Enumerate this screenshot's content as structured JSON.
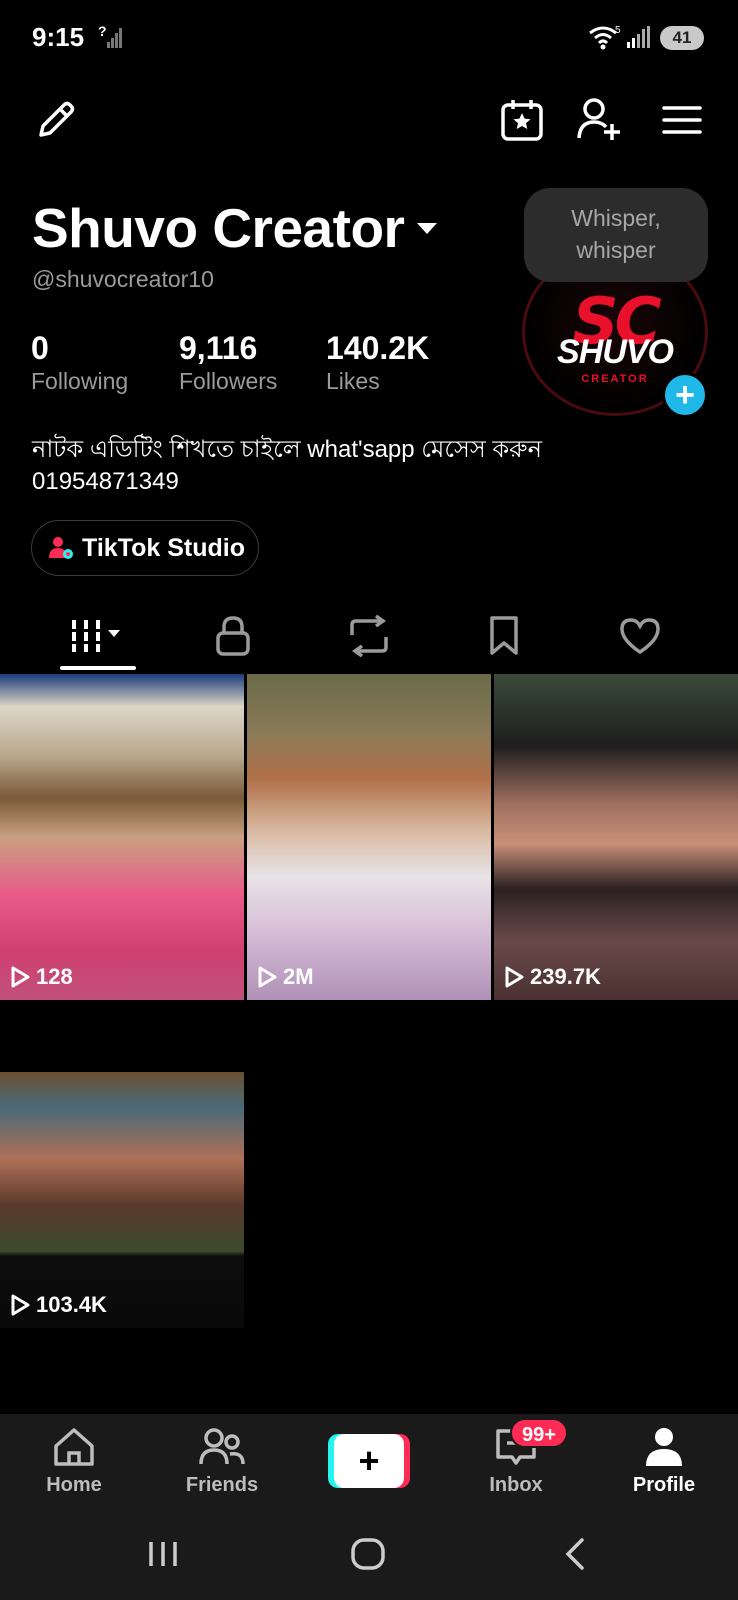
{
  "status_bar": {
    "time": "9:15",
    "sim_label": "?",
    "wifi_label": "5",
    "battery": "41"
  },
  "top_actions": {
    "icons": [
      "edit-icon",
      "calendar-star-icon",
      "add-friend-icon",
      "menu-icon"
    ]
  },
  "profile": {
    "display_name": "Shuvo Creator",
    "handle": "@shuvocreator10",
    "stats": [
      {
        "value": "0",
        "label": "Following"
      },
      {
        "value": "9,116",
        "label": "Followers"
      },
      {
        "value": "140.2K",
        "label": "Likes"
      }
    ],
    "bio_line_1": "নাটক এডিটিং শিখতে চাইলে  what'sapp মেসেস করুন",
    "bio_line_2": "01954871349",
    "studio_button": "TikTok Studio",
    "tooltip": {
      "line1": "Whisper,",
      "line2": "whisper"
    },
    "avatar_logo": {
      "mark": "SC",
      "name": "SHUVO",
      "sub": "CREATOR"
    }
  },
  "tabs": [
    {
      "name": "videos",
      "icon": "grid-icon",
      "active": true
    },
    {
      "name": "private",
      "icon": "lock-icon"
    },
    {
      "name": "reposts",
      "icon": "repost-icon"
    },
    {
      "name": "saved",
      "icon": "bookmark-icon"
    },
    {
      "name": "liked",
      "icon": "heart-icon"
    }
  ],
  "videos": [
    {
      "views": "128"
    },
    {
      "views": "2M"
    },
    {
      "views": "239.7K"
    },
    {
      "views": "103.4K"
    }
  ],
  "bottom_nav": {
    "items": [
      {
        "label": "Home",
        "icon": "home-icon"
      },
      {
        "label": "Friends",
        "icon": "friends-icon"
      },
      {
        "label": "Inbox",
        "icon": "inbox-icon"
      },
      {
        "label": "Profile",
        "icon": "profile-icon",
        "active": true
      }
    ],
    "create_label": "+",
    "inbox_badge": "99+"
  },
  "colors": {
    "accent_red": "#fe2c55",
    "accent_cyan": "#25f4ee",
    "avatar_plus": "#20b8e8"
  }
}
